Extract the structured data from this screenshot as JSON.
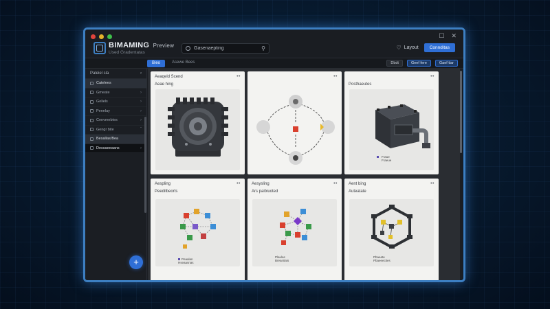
{
  "app": {
    "name": "BIMAMING",
    "name_suffix": "Preview",
    "tagline": "Used Gradentatas"
  },
  "titlebar": {
    "window_controls": [
      "☐",
      "✕"
    ]
  },
  "search": {
    "value": "",
    "placeholder": "Gasenaepting"
  },
  "top_actions": {
    "layout_label": "Layout",
    "primary_label": "Connditas"
  },
  "toolbar": {
    "active_tab": "Bieo",
    "breadcrumb": "Asewe Bees",
    "buttons": [
      "Dbdt",
      "Geef fere",
      "Gaef tiar"
    ]
  },
  "sidebar": {
    "header": "Paleiel sla",
    "header_action": "‹",
    "items": [
      {
        "label": "Catelees",
        "state": "active"
      },
      {
        "label": "Gmeate",
        "state": "normal"
      },
      {
        "label": "Geliels",
        "state": "normal"
      },
      {
        "label": "Pennlay",
        "state": "normal"
      },
      {
        "label": "Cenvmebtes",
        "state": "normal"
      },
      {
        "label": "Gengr bite",
        "state": "normal"
      },
      {
        "label": "Besallas/Bea",
        "state": "active"
      },
      {
        "label": "Dessaeeaans",
        "state": "selected"
      }
    ],
    "fab_label": "+"
  },
  "cards": [
    {
      "title": "Aeaqeld Scend",
      "subtitle": "Aeae hing",
      "menu": "••",
      "caption": []
    },
    {
      "title": "",
      "subtitle": "",
      "menu": "••",
      "caption": []
    },
    {
      "title": "",
      "subtitle": "Posthaeutes",
      "menu": "••",
      "caption": [
        "Fraue",
        "Fraeue"
      ]
    },
    {
      "title": "Aespling",
      "subtitle": "Peedilbeorts",
      "menu": "••",
      "caption": [
        "Peaalan",
        "Hseaasnas"
      ]
    },
    {
      "title": "Aesysling",
      "subtitle": "Ars paibiuoted",
      "menu": "••",
      "caption": [
        "Plaulas",
        "Breanitats"
      ]
    },
    {
      "title": "Aent bing",
      "subtitle": "Auteatate",
      "menu": "••",
      "caption": [
        "Pbaeate",
        "Pbaeeecties"
      ]
    }
  ],
  "colors": {
    "accent": "#2f6fd6",
    "frame": "#3d7fc2",
    "window_bg": "#1b1e23",
    "card_bg": "#f3f3f1"
  }
}
